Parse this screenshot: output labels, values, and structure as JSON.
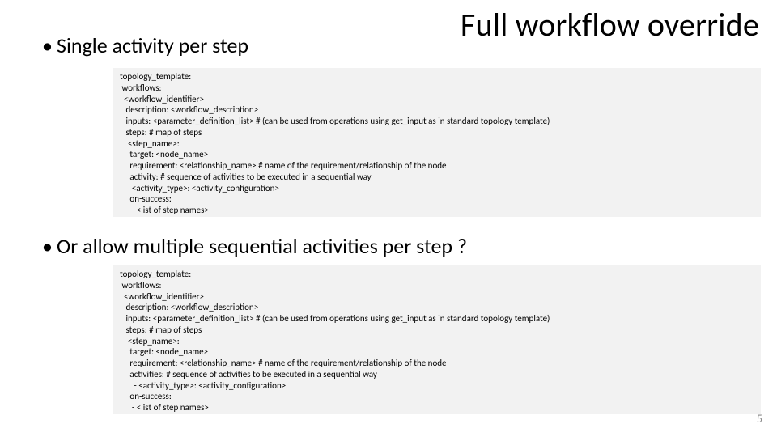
{
  "title": "Full workflow override",
  "bullets": {
    "b1": "Single activity per step",
    "b2": "Or allow multiple sequential activities per step ?"
  },
  "codeblocks": {
    "c1": "topology_template:\n workflows:\n  <workflow_identifier>\n   description: <workflow_description>\n   inputs: <parameter_definition_list> # (can be used from operations using get_input as in standard topology template)\n   steps: # map of steps\n    <step_name>:\n     target: <node_name>\n     requirement: <relationship_name> # name of the requirement/relationship of the node\n     activity: # sequence of activities to be executed in a sequential way\n      <activity_type>: <activity_configuration>\n     on-success:\n      - <list of step names>",
    "c2": "topology_template:\n workflows:\n  <workflow_identifier>\n   description: <workflow_description>\n   inputs: <parameter_definition_list> # (can be used from operations using get_input as in standard topology template)\n   steps: # map of steps\n    <step_name>:\n     target: <node_name>\n     requirement: <relationship_name> # name of the requirement/relationship of the node\n     activities: # sequence of activities to be executed in a sequential way\n       - <activity_type>: <activity_configuration>\n     on-success:\n      - <list of step names>"
  },
  "page_number": "5"
}
